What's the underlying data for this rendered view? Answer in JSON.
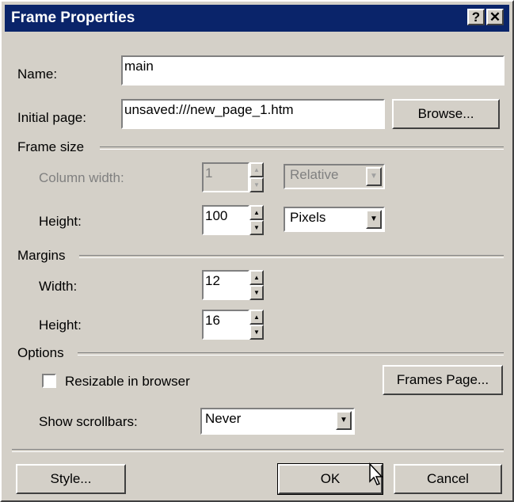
{
  "window": {
    "title": "Frame Properties",
    "help_glyph": "?",
    "close_glyph": "✕"
  },
  "name": {
    "label": "Name:",
    "value": "main"
  },
  "initial_page": {
    "label": "Initial page:",
    "value": "unsaved:///new_page_1.htm",
    "browse_label": "Browse..."
  },
  "frame_size": {
    "group_label": "Frame size",
    "column_width": {
      "label": "Column width:",
      "value": "1",
      "unit": "Relative",
      "disabled": true
    },
    "height": {
      "label": "Height:",
      "value": "100",
      "unit": "Pixels"
    }
  },
  "margins": {
    "group_label": "Margins",
    "width": {
      "label": "Width:",
      "value": "12"
    },
    "height": {
      "label": "Height:",
      "value": "16"
    }
  },
  "options": {
    "group_label": "Options",
    "resizable_label": "Resizable in browser",
    "resizable_checked": false,
    "frames_page_label": "Frames Page...",
    "scrollbars_label": "Show scrollbars:",
    "scrollbars_value": "Never"
  },
  "footer": {
    "style_label": "Style...",
    "ok_label": "OK",
    "cancel_label": "Cancel"
  },
  "icons": {
    "spin_up": "▲",
    "spin_down": "▼",
    "dropdown": "▼"
  },
  "colors": {
    "title_bar": "#0a246a",
    "face": "#d4d0c8"
  }
}
